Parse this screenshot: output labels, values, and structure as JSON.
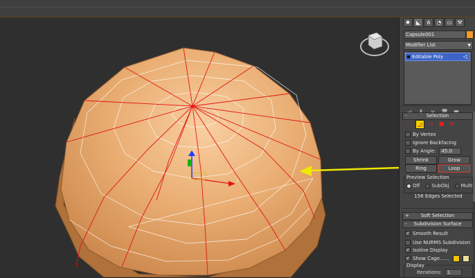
{
  "viewport": {
    "gizmo_x_label": "x"
  },
  "command_panel": {
    "tabs": [
      "create",
      "modify",
      "hierarchy",
      "motion",
      "display",
      "utilities"
    ],
    "object_name": "Capsule001",
    "object_color": "#f39a2b",
    "modifier_list": "Modifier List",
    "stack": {
      "items": [
        {
          "label": "Editable Poly",
          "selected": true
        }
      ]
    }
  },
  "selection": {
    "title": "Selection",
    "by_vertex": "By Vertex",
    "ignore_backfacing": "Ignore Backfacing",
    "by_angle": "By Angle:",
    "angle_value": "45.0",
    "shrink": "Shrink",
    "grow": "Grow",
    "ring": "Ring",
    "loop": "Loop",
    "preview_selection": "Preview Selection",
    "preview_options": [
      "Off",
      "SubObj",
      "Multi"
    ],
    "preview_selected": "Off",
    "status": "156 Edges Selected"
  },
  "soft_selection": {
    "title": "Soft Selection"
  },
  "subdivision_surface": {
    "title": "Subdivision Surface",
    "smooth_result": "Smooth Result",
    "smooth_result_checked": true,
    "use_nurms": "Use NURMS Subdivision",
    "use_nurms_checked": false,
    "isoline_display": "Isoline Display",
    "isoline_display_checked": true,
    "show_cage": "Show Cage......",
    "show_cage_checked": true,
    "cage_color_1": "#f2c300",
    "cage_color_2": "#e8e09a",
    "display_group": "Display",
    "iterations_label": "Iterations:",
    "iterations_value": "1"
  },
  "colors": {
    "selected_edge": "#e01515",
    "arrow": "#f0e800",
    "mesh_fill": "#d9935a"
  }
}
